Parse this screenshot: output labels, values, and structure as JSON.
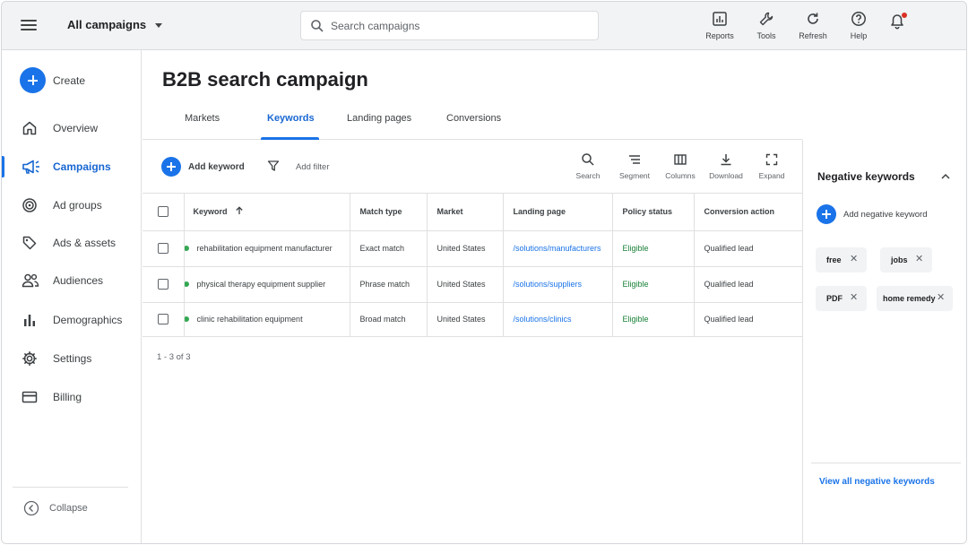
{
  "header": {
    "campaign_selector": "All campaigns",
    "search_placeholder": "Search campaigns",
    "tools": [
      {
        "label": "Reports",
        "icon": "reports-icon"
      },
      {
        "label": "Tools",
        "icon": "wrench-icon"
      },
      {
        "label": "Refresh",
        "icon": "refresh-icon"
      },
      {
        "label": "Help",
        "icon": "help-icon"
      }
    ],
    "notification_icon": "bell-icon"
  },
  "sidebar": {
    "create_label": "Create",
    "items": [
      {
        "label": "Overview",
        "icon": "home-icon"
      },
      {
        "label": "Campaigns",
        "icon": "megaphone-icon",
        "active": true
      },
      {
        "label": "Ad groups",
        "icon": "target-icon"
      },
      {
        "label": "Ads & assets",
        "icon": "tag-icon"
      },
      {
        "label": "Audiences",
        "icon": "people-icon"
      },
      {
        "label": "Demographics",
        "icon": "bar-chart-icon"
      },
      {
        "label": "Settings",
        "icon": "gear-icon"
      },
      {
        "label": "Billing",
        "icon": "card-icon"
      }
    ],
    "collapse_label": "Collapse"
  },
  "page": {
    "title": "B2B search campaign",
    "tabs": [
      {
        "label": "Markets"
      },
      {
        "label": "Keywords",
        "active": true
      },
      {
        "label": "Landing pages"
      },
      {
        "label": "Conversions"
      }
    ]
  },
  "toolbar": {
    "add_keyword": "Add keyword",
    "add_filter": "Add filter",
    "tools": [
      {
        "label": "Search",
        "icon": "search-icon"
      },
      {
        "label": "Segment",
        "icon": "segment-icon"
      },
      {
        "label": "Columns",
        "icon": "columns-icon"
      },
      {
        "label": "Download",
        "icon": "download-icon"
      },
      {
        "label": "Expand",
        "icon": "expand-icon"
      }
    ]
  },
  "table": {
    "columns": [
      "Keyword",
      "Match type",
      "Market",
      "Landing page",
      "Policy status",
      "Conversion action"
    ],
    "rows": [
      {
        "keyword": "rehabilitation equipment manufacturer",
        "match_type": "Exact match",
        "market": "United States",
        "landing_page": "/solutions/manufacturers",
        "policy_status": "Eligible",
        "conversion_action": "Qualified lead"
      },
      {
        "keyword": "physical therapy equipment supplier",
        "match_type": "Phrase match",
        "market": "United States",
        "landing_page": "/solutions/suppliers",
        "policy_status": "Eligible",
        "conversion_action": "Qualified lead"
      },
      {
        "keyword": "clinic rehabilitation equipment",
        "match_type": "Broad match",
        "market": "United States",
        "landing_page": "/solutions/clinics",
        "policy_status": "Eligible",
        "conversion_action": "Qualified lead"
      }
    ],
    "pagination": "1 - 3 of 3"
  },
  "negative_keywords": {
    "title": "Negative keywords",
    "add_label": "Add negative keyword",
    "chips": [
      "free",
      "jobs",
      "PDF",
      "home remedy"
    ],
    "view_all": "View all negative keywords"
  },
  "colors": {
    "accent": "#1a73e8",
    "eligible": "#188038",
    "status_dot": "#34a853",
    "notification_dot": "#d93025"
  }
}
